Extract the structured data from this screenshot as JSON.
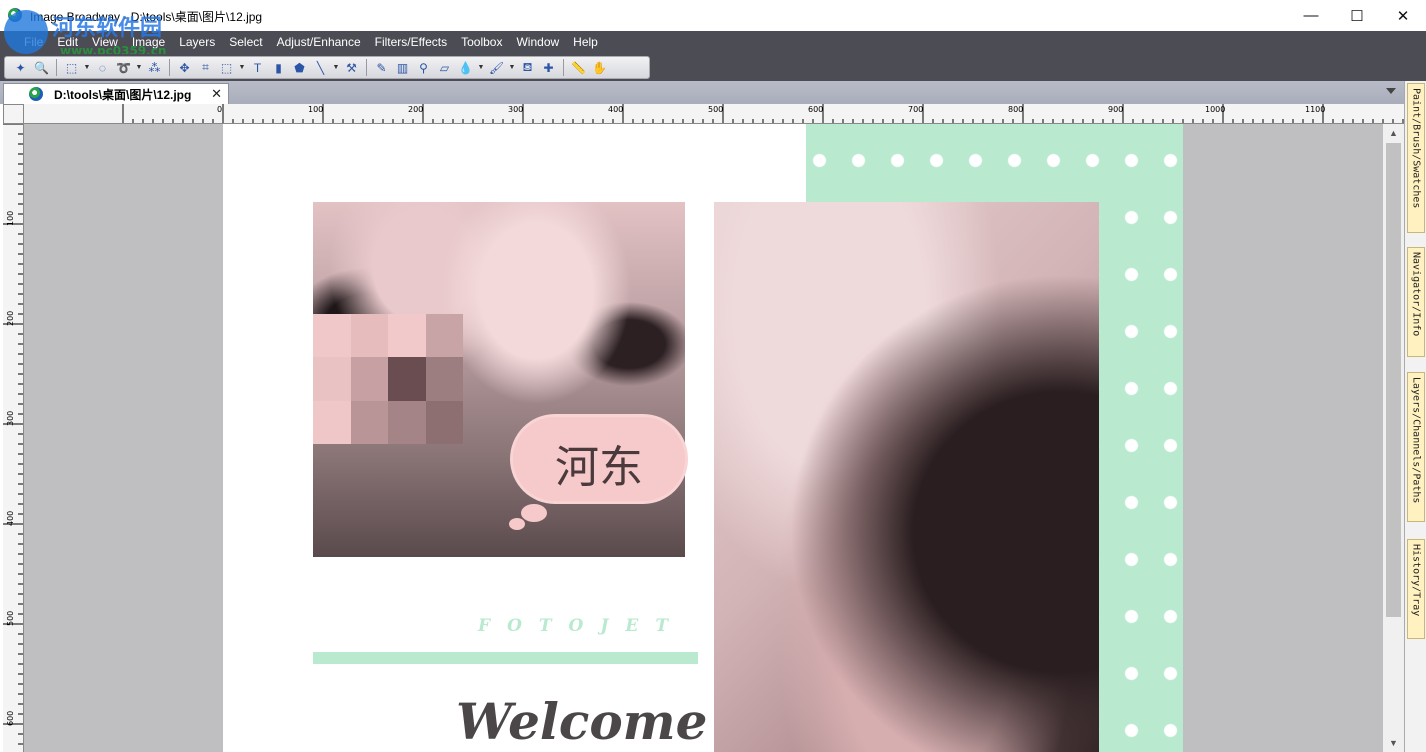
{
  "window": {
    "title": "Image Broadway - D:\\tools\\桌面\\图片\\12.jpg",
    "minimize": "—",
    "maximize": "☐",
    "close": "✕"
  },
  "watermark": {
    "text": "河东软件园",
    "url": "www.pc0359.cn"
  },
  "menu": [
    "File",
    "Edit",
    "View",
    "Image",
    "Layers",
    "Select",
    "Adjust/Enhance",
    "Filters/Effects",
    "Toolbox",
    "Window",
    "Help"
  ],
  "toolbar_icons": [
    "wand-icon",
    "zoom-icon",
    "rect-select-icon",
    "ellipse-select-icon",
    "lasso-icon",
    "magic-wand-icon",
    "move-icon",
    "crop-icon",
    "transform-icon",
    "text-icon",
    "gradient-icon",
    "shape-icon",
    "line-icon",
    "clone-icon",
    "pencil-icon",
    "tube-icon",
    "dropper-icon",
    "eraser-icon",
    "drop-icon",
    "brush-icon",
    "stamp-icon",
    "heal-icon",
    "ruler-icon",
    "hand-icon"
  ],
  "doc_tab": {
    "label": "D:\\tools\\桌面\\图片\\12.jpg",
    "close": "✕"
  },
  "ruler": {
    "h": [
      "0",
      "100",
      "200",
      "300",
      "400",
      "500",
      "600",
      "700",
      "800",
      "900",
      "1000",
      "1100"
    ],
    "v": [
      "100",
      "200",
      "300",
      "400",
      "500",
      "600"
    ]
  },
  "image": {
    "bubble_text": "河东",
    "fotojet": "FOTOJET",
    "welcome": "Welcome",
    "colors": {
      "mint": "#b9ead0",
      "pink": "#f6c9cb",
      "dark_text": "#4b4749"
    }
  },
  "dock_tabs": [
    "Paint/Brush/Swatches",
    "Navigator/Info",
    "Layers/Channels/Paths",
    "History/Tray"
  ]
}
